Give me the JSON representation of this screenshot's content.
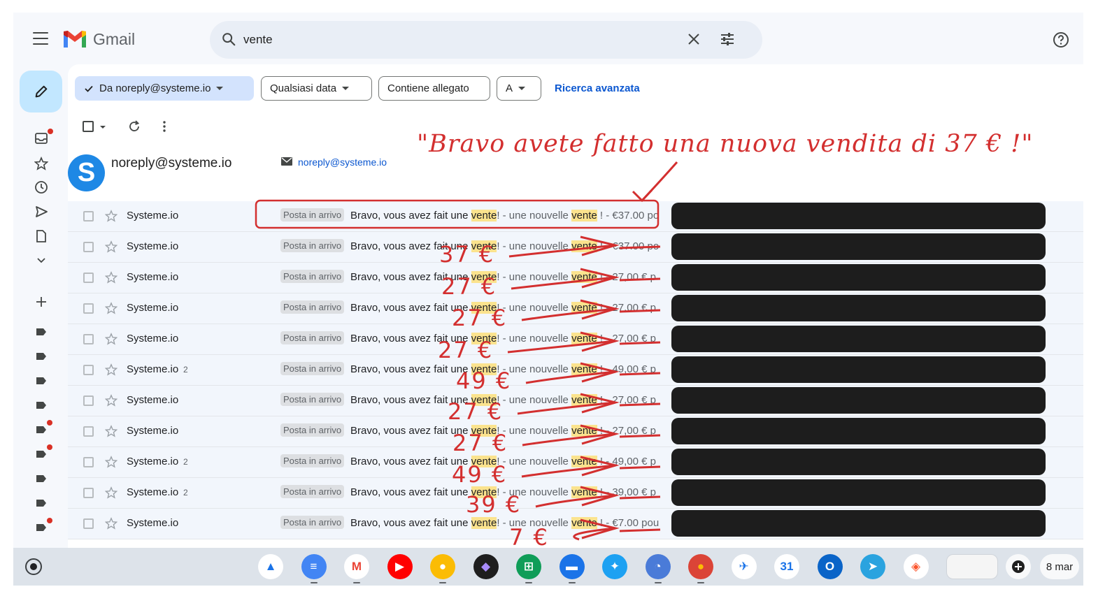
{
  "header": {
    "app_name": "Gmail",
    "search_value": "vente"
  },
  "filters": {
    "from_chip": "Da noreply@systeme.io",
    "date_chip": "Qualsiasi data",
    "attachment_chip": "Contiene allegato",
    "to_chip": "A",
    "advanced_link": "Ricerca avanzata"
  },
  "contact": {
    "avatar_letter": "S",
    "name": "noreply@systeme.io",
    "email": "noreply@systeme.io"
  },
  "emails": [
    {
      "sender": "Systeme.io",
      "count": "",
      "label": "Posta in arrivo",
      "pre": "Bravo, vous avez fait une ",
      "hl1": "vente",
      "mid": "! - une nouvelle ",
      "hl2": "vente",
      "post": " ! - €37.00 po"
    },
    {
      "sender": "Systeme.io",
      "count": "",
      "label": "Posta in arrivo",
      "pre": "Bravo, vous avez fait une ",
      "hl1": "vente",
      "mid": "! - une nouvelle ",
      "hl2": "vente",
      "post": " ! - €37.00 po"
    },
    {
      "sender": "Systeme.io",
      "count": "",
      "label": "Posta in arrivo",
      "pre": "Bravo, vous avez fait une ",
      "hl1": "vente",
      "mid": "! - une nouvelle ",
      "hl2": "vente",
      "post": " ! - 27,00 € p"
    },
    {
      "sender": "Systeme.io",
      "count": "",
      "label": "Posta in arrivo",
      "pre": "Bravo, vous avez fait une ",
      "hl1": "vente",
      "mid": "! - une nouvelle ",
      "hl2": "vente",
      "post": " ! - 27,00 € p"
    },
    {
      "sender": "Systeme.io",
      "count": "",
      "label": "Posta in arrivo",
      "pre": "Bravo, vous avez fait une ",
      "hl1": "vente",
      "mid": "! - une nouvelle ",
      "hl2": "vente",
      "post": " ! - 27,00 € p"
    },
    {
      "sender": "Systeme.io",
      "count": "2",
      "label": "Posta in arrivo",
      "pre": "Bravo, vous avez fait une ",
      "hl1": "vente",
      "mid": "! - une nouvelle ",
      "hl2": "vente",
      "post": " ! - 49,00 € p"
    },
    {
      "sender": "Systeme.io",
      "count": "",
      "label": "Posta in arrivo",
      "pre": "Bravo, vous avez fait une ",
      "hl1": "vente",
      "mid": "! - une nouvelle ",
      "hl2": "vente",
      "post": " ! - 27,00 € p"
    },
    {
      "sender": "Systeme.io",
      "count": "",
      "label": "Posta in arrivo",
      "pre": "Bravo, vous avez fait une ",
      "hl1": "vente",
      "mid": "! - une nouvelle ",
      "hl2": "vente",
      "post": " ! - 27,00 € p"
    },
    {
      "sender": "Systeme.io",
      "count": "2",
      "label": "Posta in arrivo",
      "pre": "Bravo, vous avez fait une ",
      "hl1": "vente",
      "mid": "! - une nouvelle ",
      "hl2": "vente",
      "post": " ! - 49,00 € p"
    },
    {
      "sender": "Systeme.io",
      "count": "2",
      "label": "Posta in arrivo",
      "pre": "Bravo, vous avez fait une ",
      "hl1": "vente",
      "mid": "! - une nouvelle ",
      "hl2": "vente",
      "post": " ! - 39,00 € p"
    },
    {
      "sender": "Systeme.io",
      "count": "",
      "label": "Posta in arrivo",
      "pre": "Bravo, vous avez fait une ",
      "hl1": "vente",
      "mid": "! - une nouvelle ",
      "hl2": "vente",
      "post": " ! - €7.00 pou"
    }
  ],
  "annotations": {
    "caption": "\"Bravo avete fatto una nuova vendita di 37 € !\"",
    "amounts": [
      "37 €",
      "27 €",
      "27 €",
      "27 €",
      "49 €",
      "27 €",
      "27 €",
      "49 €",
      "39 €",
      "7 €"
    ],
    "color": "#d32f2f"
  },
  "taskbar": {
    "date": "8 mar",
    "sheets_glyph": "⊞",
    "calendar_glyph": "31",
    "outlook_glyph": "O",
    "apps": [
      "drive",
      "docs",
      "gmail",
      "youtube",
      "keep",
      "obsidian",
      "sheets",
      "files",
      "twitter",
      "clock",
      "chrome",
      "navigator",
      "calendar",
      "outlook",
      "telegram",
      "brave"
    ]
  },
  "colors": {
    "accent_blue": "#0b57d0",
    "chip_active": "#d3e3fd",
    "compose": "#c2e7ff",
    "highlight": "#fbe38e",
    "notification_red": "#d93025"
  }
}
